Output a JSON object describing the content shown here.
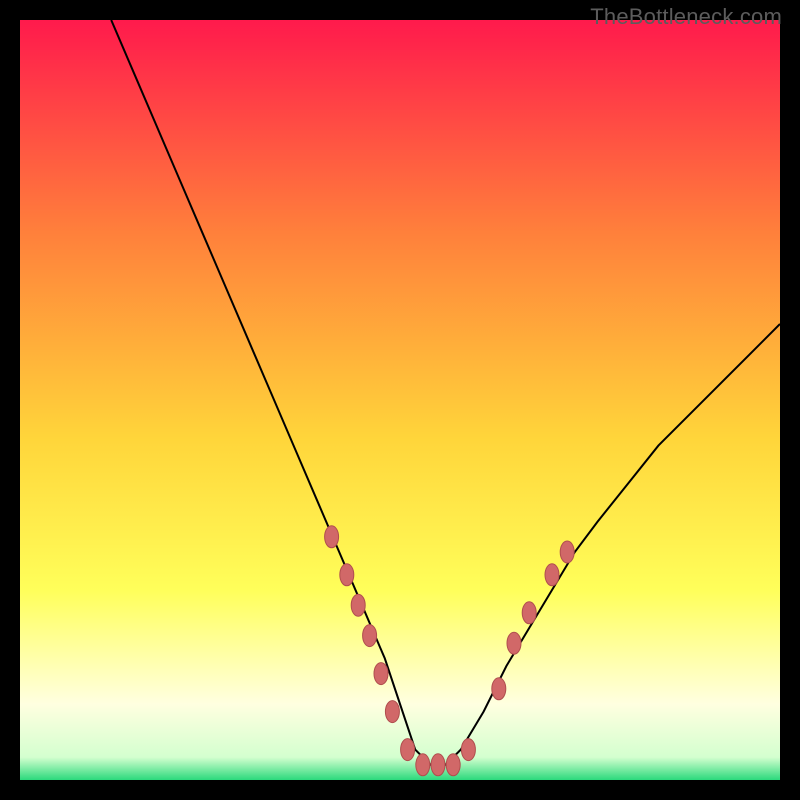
{
  "watermark": "TheBottleneck.com",
  "colors": {
    "frame": "#000000",
    "grad_top": "#ff1a4c",
    "grad_mid1": "#ff803b",
    "grad_mid2": "#ffd53a",
    "grad_mid3": "#ffff5a",
    "grad_pale": "#ffffe0",
    "grad_green": "#2bd97c",
    "curve": "#000000",
    "marker_fill": "#d16868",
    "marker_stroke": "#b04e4e"
  },
  "chart_data": {
    "type": "line",
    "title": "",
    "xlabel": "",
    "ylabel": "",
    "xlim": [
      0,
      100
    ],
    "ylim": [
      0,
      100
    ],
    "series": [
      {
        "name": "bottleneck-curve",
        "x": [
          12,
          15,
          18,
          21,
          24,
          27,
          30,
          33,
          36,
          39,
          42,
          45,
          48,
          50,
          52,
          54,
          56,
          58,
          61,
          64,
          67,
          70,
          73,
          76,
          80,
          84,
          88,
          92,
          96,
          100
        ],
        "y": [
          100,
          93,
          86,
          79,
          72,
          65,
          58,
          51,
          44,
          37,
          30,
          23,
          16,
          10,
          4,
          2,
          2,
          4,
          9,
          15,
          20,
          25,
          30,
          34,
          39,
          44,
          48,
          52,
          56,
          60
        ]
      }
    ],
    "markers": {
      "name": "highlight-dots",
      "points": [
        {
          "x": 41,
          "y": 32
        },
        {
          "x": 43,
          "y": 27
        },
        {
          "x": 44.5,
          "y": 23
        },
        {
          "x": 46,
          "y": 19
        },
        {
          "x": 47.5,
          "y": 14
        },
        {
          "x": 49,
          "y": 9
        },
        {
          "x": 51,
          "y": 4
        },
        {
          "x": 53,
          "y": 2
        },
        {
          "x": 55,
          "y": 2
        },
        {
          "x": 57,
          "y": 2
        },
        {
          "x": 59,
          "y": 4
        },
        {
          "x": 63,
          "y": 12
        },
        {
          "x": 65,
          "y": 18
        },
        {
          "x": 67,
          "y": 22
        },
        {
          "x": 70,
          "y": 27
        },
        {
          "x": 72,
          "y": 30
        }
      ]
    }
  }
}
